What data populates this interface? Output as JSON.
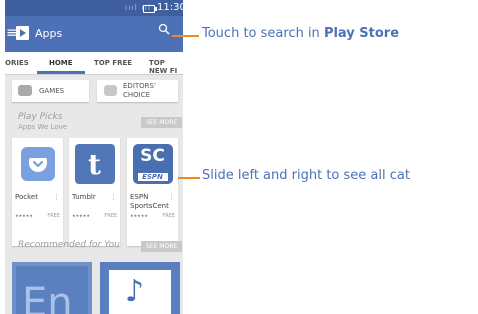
{
  "status_bar": {
    "signal": "ıııl ııl",
    "time": "11:30"
  },
  "app_bar": {
    "title": "Apps"
  },
  "tabs": [
    {
      "label": "ORIES"
    },
    {
      "label": "HOME"
    },
    {
      "label": "TOP FREE"
    },
    {
      "label": "TOP NEW FI"
    }
  ],
  "categories": [
    {
      "label": "GAMES"
    },
    {
      "label": "EDITORS' CHOICE"
    }
  ],
  "play_picks": {
    "title": "Play Picks",
    "subtitle": "Apps We Love",
    "see_more": "SEE MORE",
    "apps": [
      {
        "name": "Pocket",
        "stars": "★★★★★",
        "price": "FREE"
      },
      {
        "name": "Tumblr",
        "stars": "★★★★★",
        "price": "FREE"
      },
      {
        "name": "ESPN SportsCent",
        "stars": "★★★★★",
        "price": "FREE"
      }
    ]
  },
  "recommended": {
    "title": "Recommended for You",
    "see_more": "SEE MORE"
  },
  "callouts": {
    "search_prefix": "Touch to search in ",
    "search_bold": "Play Store",
    "slide": "Slide left and right to see all cat"
  },
  "icons": {
    "menu": "menu-icon",
    "search": "search-icon",
    "store": "play-store-icon"
  },
  "colors": {
    "appbar": "#4d71b6",
    "callout_text": "#4d71b6",
    "callout_line": "#f08a24"
  }
}
